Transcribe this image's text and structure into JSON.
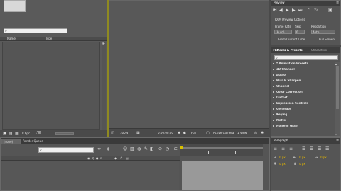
{
  "project": {
    "search_placeholder": "",
    "columns": [
      "Name",
      "Type"
    ],
    "footer_bpc": "8 bpc"
  },
  "composition": {
    "zoom": "100%",
    "timecode": "0:00:00:00",
    "resolution": "Full",
    "camera": "Active Camera",
    "views": "1 View"
  },
  "preview": {
    "title": "Preview",
    "ram_options_label": "RAM Preview Options",
    "frame_rate_label": "Frame Rate",
    "skip_label": "Skip",
    "resolution_label": "Resolution",
    "frame_rate_value": "(Auto)",
    "skip_value": "0",
    "resolution_value": "Auto",
    "from_current_time": "From Current Time",
    "full_screen": "Full Screen"
  },
  "effects": {
    "tab_info": "Info",
    "tab_effects": "Effects & Presets",
    "tab_characters": "Characters",
    "items": [
      "* Animation Presets",
      "3D Channel",
      "Audio",
      "Blur & Sharpen",
      "Channel",
      "Color Correction",
      "Distort",
      "Expression Controls",
      "Generate",
      "Keying",
      "Matte",
      "Noise & Grain"
    ]
  },
  "timeline": {
    "tab_none": "(none)",
    "tab_render_queue": "Render Queue"
  },
  "paragraph": {
    "title": "Paragraph",
    "indent_values": [
      "0 px",
      "0 px",
      "0 px",
      "0 px",
      "0 px"
    ]
  }
}
